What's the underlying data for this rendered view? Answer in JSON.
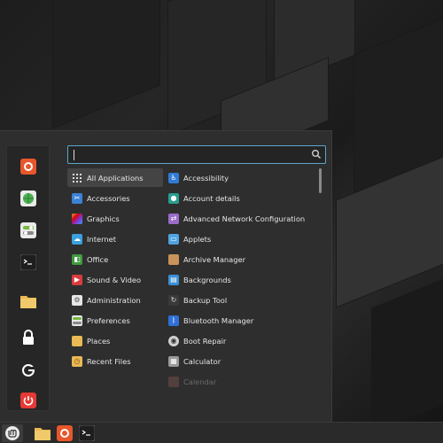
{
  "search": {
    "value": "",
    "placeholder": ""
  },
  "sidebar": {
    "favorites": [
      {
        "name": "firefox",
        "icon": "firefox-icon",
        "color": "#e8572b"
      },
      {
        "name": "software-manager",
        "icon": "software-manager-icon",
        "color": "#4caf50"
      },
      {
        "name": "settings",
        "icon": "settings-icon",
        "color": "#79b742"
      },
      {
        "name": "terminal",
        "icon": "terminal-icon",
        "color": "#2b2b2b"
      },
      {
        "name": "files",
        "icon": "folder-icon",
        "color": "#e8b955"
      },
      {
        "name": "lock-screen",
        "icon": "lock-icon",
        "color": "#ffffff"
      },
      {
        "name": "logout",
        "icon": "logout-icon",
        "color": "#ffffff"
      },
      {
        "name": "shutdown",
        "icon": "power-icon",
        "color": "#e53935"
      }
    ]
  },
  "categories": [
    {
      "label": "All Applications",
      "icon": "grid-icon",
      "selected": true
    },
    {
      "label": "Accessories",
      "icon": "accessories-icon",
      "color": "#3b82d6"
    },
    {
      "label": "Graphics",
      "icon": "graphics-icon",
      "color": "#c2409b"
    },
    {
      "label": "Internet",
      "icon": "internet-icon",
      "color": "#3aa0e0"
    },
    {
      "label": "Office",
      "icon": "office-icon",
      "color": "#3f9a3f"
    },
    {
      "label": "Sound & Video",
      "icon": "sound-video-icon",
      "color": "#d83c3c"
    },
    {
      "label": "Administration",
      "icon": "administration-icon",
      "color": "#8c8c8c"
    },
    {
      "label": "Preferences",
      "icon": "preferences-icon",
      "color": "#79b742"
    },
    {
      "label": "Places",
      "icon": "places-folder-icon",
      "color": "#e8b955"
    },
    {
      "label": "Recent Files",
      "icon": "recent-files-icon",
      "color": "#e8b955"
    }
  ],
  "applications": [
    {
      "label": "Accessibility",
      "icon": "accessibility-icon",
      "color": "#2f7bd6"
    },
    {
      "label": "Account details",
      "icon": "account-details-icon",
      "color": "#2a9d8f"
    },
    {
      "label": "Advanced Network Configuration",
      "icon": "network-config-icon",
      "color": "#9a6cc8"
    },
    {
      "label": "Applets",
      "icon": "applets-icon",
      "color": "#4fa3e0"
    },
    {
      "label": "Archive Manager",
      "icon": "archive-manager-icon",
      "color": "#c8935a"
    },
    {
      "label": "Backgrounds",
      "icon": "backgrounds-icon",
      "color": "#3b8fd6"
    },
    {
      "label": "Backup Tool",
      "icon": "backup-tool-icon",
      "color": "#dddddd"
    },
    {
      "label": "Bluetooth Manager",
      "icon": "bluetooth-icon",
      "color": "#2f6fd6"
    },
    {
      "label": "Boot Repair",
      "icon": "boot-repair-icon",
      "color": "#d0d0d0"
    },
    {
      "label": "Calculator",
      "icon": "calculator-icon",
      "color": "#9a9a9a"
    },
    {
      "label": "Calendar",
      "icon": "calendar-icon",
      "color": "#7a5050",
      "dim": true
    }
  ],
  "taskbar": {
    "items": [
      {
        "name": "menu",
        "icon": "mint-menu-icon"
      },
      {
        "name": "files",
        "icon": "folder-icon"
      },
      {
        "name": "firefox",
        "icon": "firefox-icon"
      },
      {
        "name": "terminal",
        "icon": "terminal-icon"
      }
    ]
  }
}
